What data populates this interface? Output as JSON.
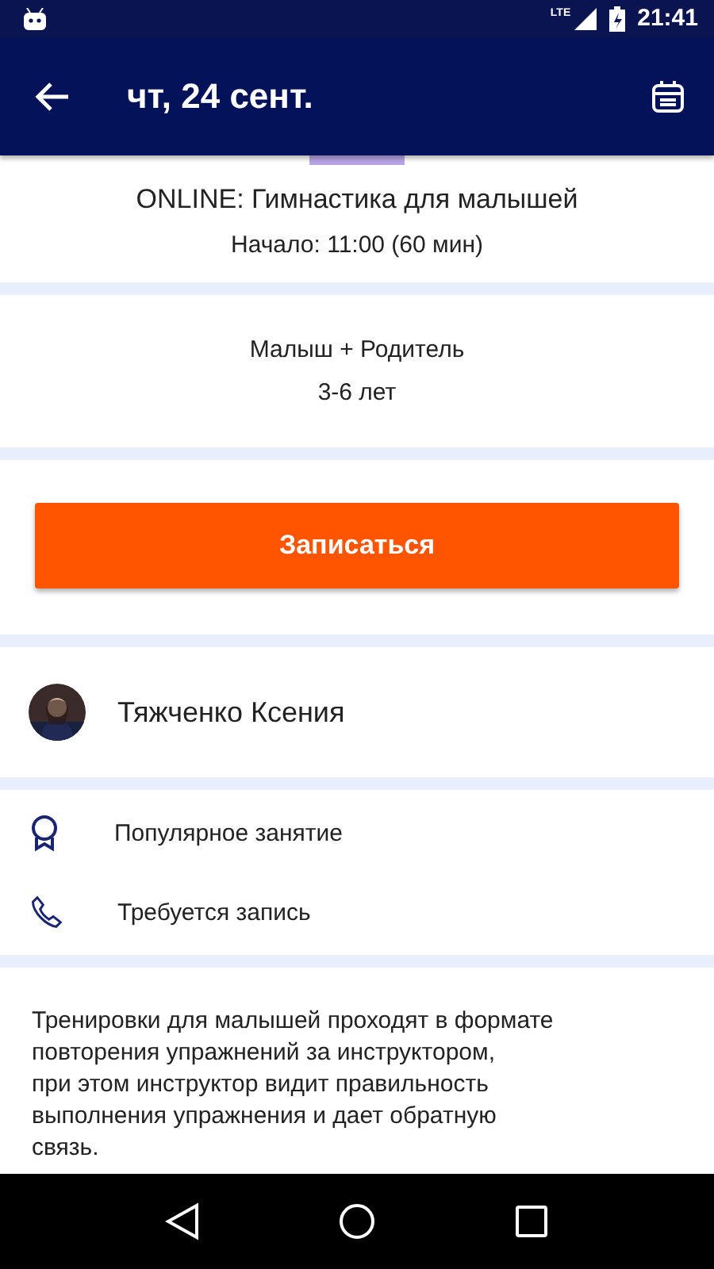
{
  "status_bar": {
    "time": "21:41",
    "network": "LTE"
  },
  "app_bar": {
    "title": "чт, 24 сент."
  },
  "event": {
    "title": "ONLINE: Гимнастика для малышей",
    "start": "Начало: 11:00 (60 мин)"
  },
  "audience": {
    "group": "Малыш + Родитель",
    "age": "3-6 лет"
  },
  "signup_button": "Записаться",
  "instructor": {
    "name": "Тяжченко Ксения"
  },
  "features": [
    {
      "kind": "award",
      "label": "Популярное занятие"
    },
    {
      "kind": "phone",
      "label": "Требуется запись"
    }
  ],
  "description": [
    "Тренировки для малышей проходят в формате",
    "повторения упражнений за инструктором,",
    "при этом инструктор видит правильность",
    "выполнения упражнения и дает обратную",
    "связь."
  ]
}
